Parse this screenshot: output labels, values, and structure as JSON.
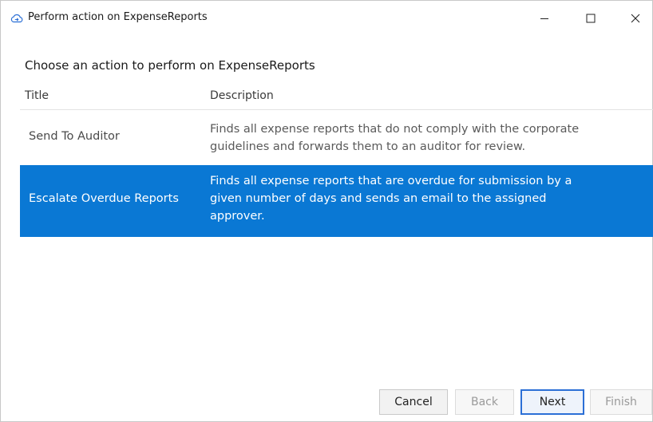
{
  "window": {
    "title": "Perform action on ExpenseReports",
    "icon": "cloud-icon",
    "controls": {
      "minimize": "—",
      "maximize": "☐",
      "close": "✕"
    }
  },
  "dialog": {
    "heading": "Choose an action to perform on ExpenseReports",
    "columns": {
      "title": "Title",
      "description": "Description"
    },
    "rows": [
      {
        "title": "Send To Auditor",
        "description_lines": [
          "Finds all expense reports that do not comply with the corporate",
          "guidelines and forwards them to an auditor for review."
        ],
        "selected": false
      },
      {
        "title": "Escalate Overdue Reports",
        "description_lines": [
          "Finds all expense reports that are overdue for submission by a",
          "given number of days and sends an email to the assigned",
          "approver."
        ],
        "selected": true
      }
    ],
    "selection_color": "#0a78d4"
  },
  "buttons": {
    "cancel": "Cancel",
    "back": "Back",
    "next": "Next",
    "finish": "Finish"
  }
}
